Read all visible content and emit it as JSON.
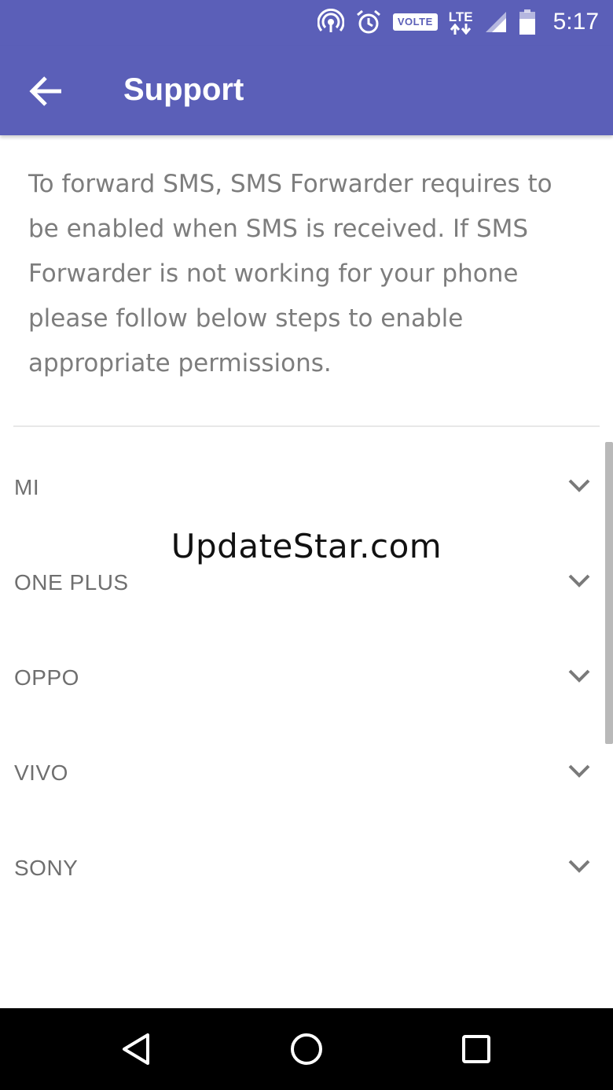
{
  "status_bar": {
    "time": "5:17",
    "volte": "VOLTE",
    "lte": "LTE",
    "icons": [
      "hotspot-icon",
      "alarm-icon",
      "volte-badge",
      "lte-icon",
      "signal-icon",
      "battery-icon"
    ]
  },
  "app_bar": {
    "title": "Support",
    "back_icon": "arrow-back-icon",
    "color": "#5b5fb8"
  },
  "intro_text": "To forward SMS, SMS Forwarder requires to be enabled when SMS is received. If SMS Forwarder is not working for your phone please follow below steps to enable appropriate permissions.",
  "brands": [
    {
      "label": "MI"
    },
    {
      "label": "ONE PLUS"
    },
    {
      "label": "OPPO"
    },
    {
      "label": "VIVO"
    },
    {
      "label": "SONY"
    }
  ],
  "watermark": "UpdateStar.com",
  "nav_bar": {
    "icons": [
      "back-triangle-icon",
      "home-circle-icon",
      "recents-square-icon"
    ]
  }
}
